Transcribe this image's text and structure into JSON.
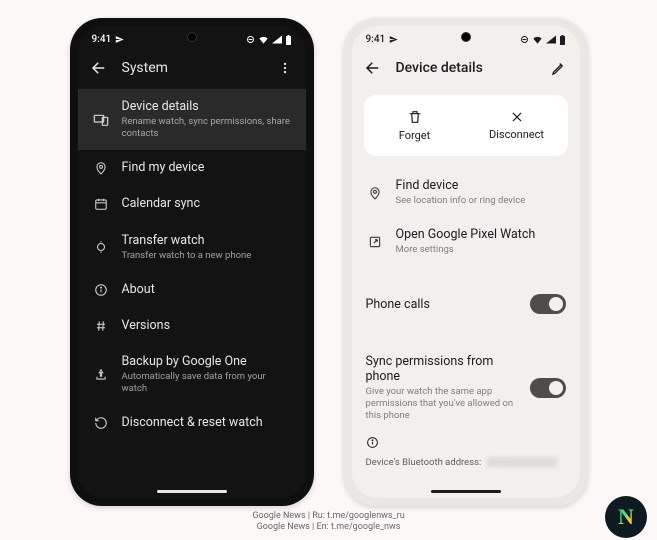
{
  "status": {
    "time": "9:41",
    "wifi": "wifi-icon",
    "signal": "signal-icon",
    "battery": "battery-icon"
  },
  "phoneA": {
    "title": "System",
    "items": [
      {
        "icon": "devices-icon",
        "label": "Device details",
        "sub": "Rename watch, sync permissions, share contacts",
        "selected": true
      },
      {
        "icon": "location-icon",
        "label": "Find my device"
      },
      {
        "icon": "calendar-icon",
        "label": "Calendar sync"
      },
      {
        "icon": "transfer-icon",
        "label": "Transfer watch",
        "sub": "Transfer watch to a new phone"
      },
      {
        "icon": "info-icon",
        "label": "About"
      },
      {
        "icon": "hash-icon",
        "label": "Versions"
      },
      {
        "icon": "backup-icon",
        "label": "Backup by Google One",
        "sub": "Automatically save data from your watch"
      },
      {
        "icon": "history-icon",
        "label": "Disconnect & reset watch"
      }
    ]
  },
  "phoneB": {
    "title": "Device details",
    "card": {
      "forget": "Forget",
      "disconnect": "Disconnect"
    },
    "items": [
      {
        "icon": "location-icon",
        "label": "Find device",
        "sub": "See location info or ring device"
      },
      {
        "icon": "open-icon",
        "label": "Open Google Pixel Watch",
        "sub": "More settings"
      }
    ],
    "toggles": [
      {
        "label": "Phone calls",
        "on": true
      },
      {
        "label": "Sync permissions from phone",
        "sub": "Give your watch the same app permissions that you've allowed on this phone",
        "on": true
      }
    ],
    "bt_label": "Device's Bluetooth address:"
  },
  "footer": {
    "line1": "Google News | Ru: t.me/googlenws_ru",
    "line2": "Google News | En: t.me/google_nws"
  }
}
